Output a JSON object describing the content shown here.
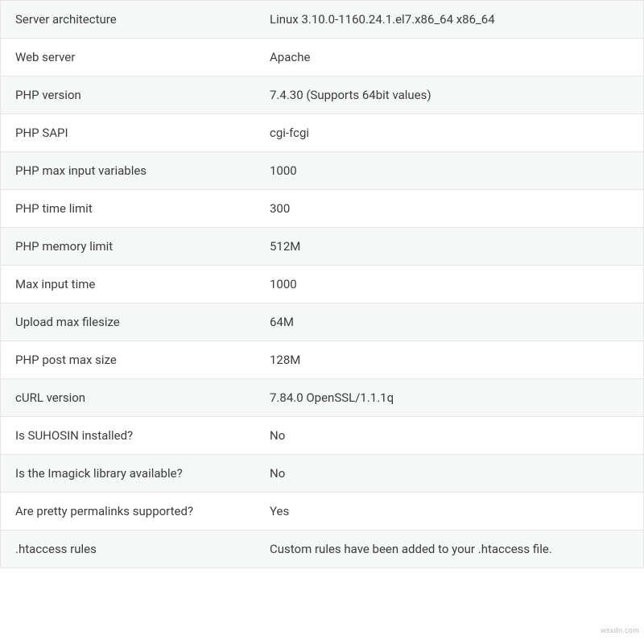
{
  "info": {
    "rows": [
      {
        "label": "Server architecture",
        "value": "Linux 3.10.0-1160.24.1.el7.x86_64 x86_64"
      },
      {
        "label": "Web server",
        "value": "Apache"
      },
      {
        "label": "PHP version",
        "value": "7.4.30 (Supports 64bit values)"
      },
      {
        "label": "PHP SAPI",
        "value": "cgi-fcgi"
      },
      {
        "label": "PHP max input variables",
        "value": "1000"
      },
      {
        "label": "PHP time limit",
        "value": "300"
      },
      {
        "label": "PHP memory limit",
        "value": "512M"
      },
      {
        "label": "Max input time",
        "value": "1000"
      },
      {
        "label": "Upload max filesize",
        "value": "64M"
      },
      {
        "label": "PHP post max size",
        "value": "128M"
      },
      {
        "label": "cURL version",
        "value": "7.84.0 OpenSSL/1.1.1q"
      },
      {
        "label": "Is SUHOSIN installed?",
        "value": "No"
      },
      {
        "label": "Is the Imagick library available?",
        "value": "No"
      },
      {
        "label": "Are pretty permalinks supported?",
        "value": "Yes"
      },
      {
        "label": ".htaccess rules",
        "value": "Custom rules have been added to your .htaccess file."
      }
    ]
  },
  "watermark": "wsxdn.com"
}
